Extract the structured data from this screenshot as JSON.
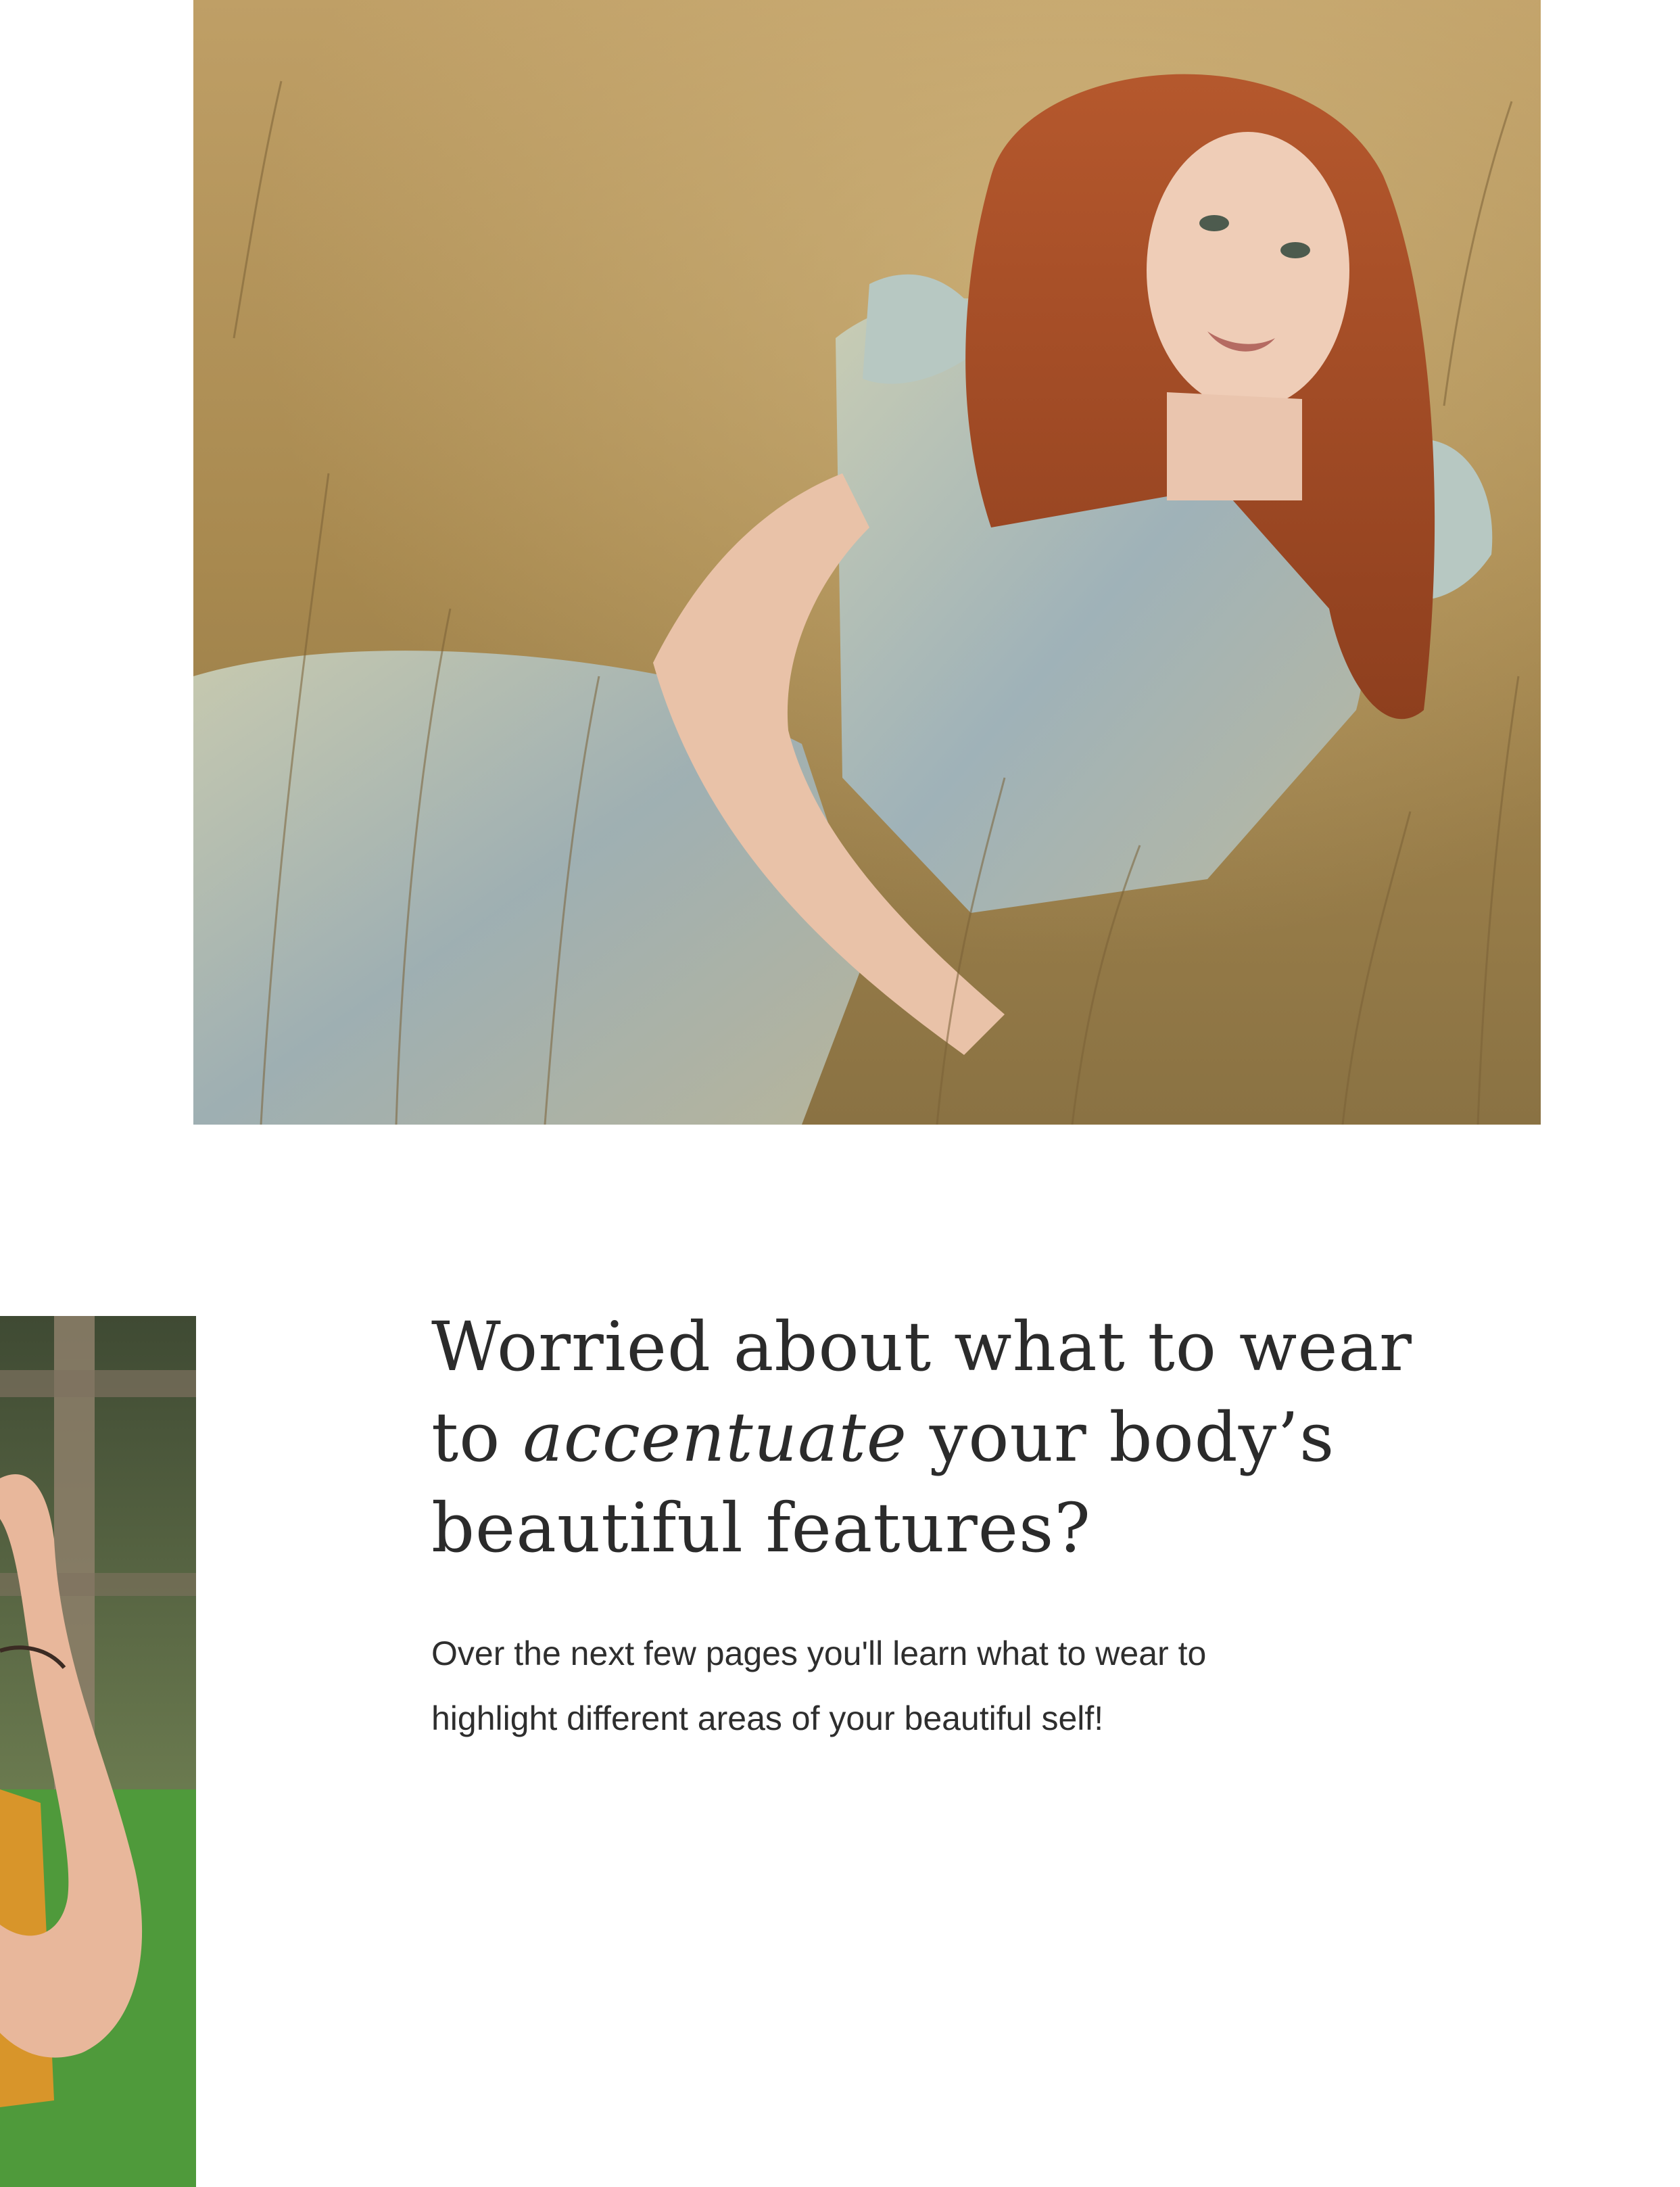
{
  "images": {
    "hero": {
      "icon": "portrait-photo-woman-in-grass-field"
    },
    "side": {
      "icon": "cropped-portrait-photo-woman-orange-dress"
    }
  },
  "headline": {
    "line1": "Worried about what to wear",
    "line2_pre": "to ",
    "line2_accent": "accentuate",
    "line2_post": " your body’s",
    "line3": "beautiful features?"
  },
  "body": {
    "text": "Over the next few pages you'll learn what to wear to highlight different areas of your beautiful self!"
  },
  "colors": {
    "text": "#2b2b2b",
    "background": "#ffffff",
    "grass": "#a98a52",
    "foliage": "#50643a"
  }
}
